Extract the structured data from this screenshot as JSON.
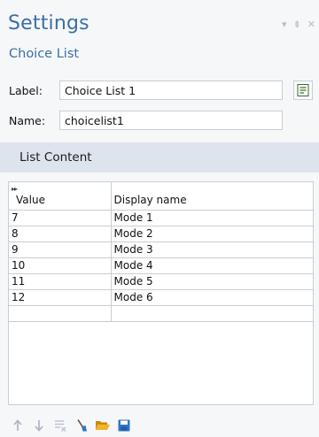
{
  "panel": {
    "title": "Settings",
    "subtitle": "Choice List"
  },
  "window_controls": {
    "menu_glyph": "▾",
    "pin_glyph": "⇟",
    "close_glyph": "✕"
  },
  "fields": {
    "label_caption": "Label:",
    "label_value": "Choice List 1",
    "name_caption": "Name:",
    "name_value": "choicelist1"
  },
  "section": {
    "title": "List Content"
  },
  "table": {
    "sort_marker": "▸▸",
    "columns": [
      "Value",
      "Display name"
    ],
    "rows": [
      [
        "7",
        "Mode 1"
      ],
      [
        "8",
        "Mode 2"
      ],
      [
        "9",
        "Mode 3"
      ],
      [
        "10",
        "Mode 4"
      ],
      [
        "11",
        "Mode 5"
      ],
      [
        "12",
        "Mode 6"
      ],
      [
        "",
        ""
      ]
    ]
  },
  "toolbar": {
    "icons": [
      "arrow-up-icon",
      "arrow-down-icon",
      "delete-list-icon",
      "clear-table-icon",
      "open-folder-icon",
      "save-icon"
    ]
  },
  "colors": {
    "accent": "#3a6fa8",
    "section_bg": "#dde4ee",
    "save_icon": "#2f76c7",
    "folder_icon": "#e8a317"
  }
}
